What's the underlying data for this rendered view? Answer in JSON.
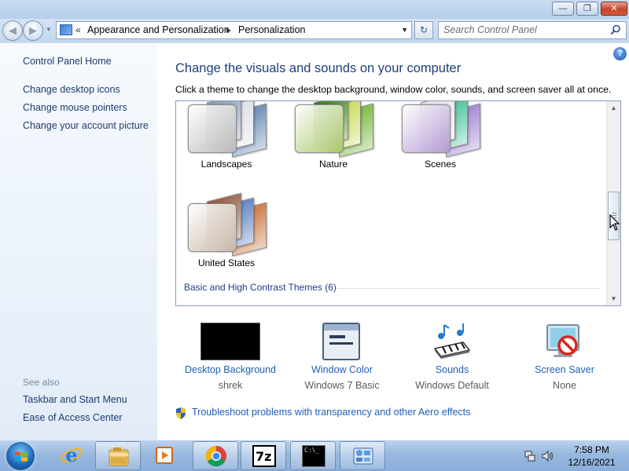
{
  "window": {
    "minimize_glyph": "—",
    "maximize_glyph": "❐",
    "close_glyph": "✕"
  },
  "navigation": {
    "back_glyph": "◀",
    "forward_glyph": "▶",
    "recent_glyph": "▼",
    "address_prefix": "«",
    "separator": "▸",
    "breadcrumbs": [
      "Appearance and Personalization",
      "Personalization"
    ],
    "address_dropdown_glyph": "▼",
    "refresh_glyph": "↻",
    "search_placeholder": "Search Control Panel"
  },
  "sidebar": {
    "home": "Control Panel Home",
    "tasks": [
      "Change desktop icons",
      "Change mouse pointers",
      "Change your account picture"
    ],
    "see_also_label": "See also",
    "see_also": [
      "Taskbar and Start Menu",
      "Ease of Access Center"
    ]
  },
  "main": {
    "help_glyph": "?",
    "title": "Change the visuals and sounds on your computer",
    "subtitle": "Click a theme to change the desktop background, window color, sounds, and screen saver all at once.",
    "themes": [
      {
        "name": "Landscapes",
        "tint": "#b9b9b9",
        "tiles": [
          "#5a7fb0",
          "#d9dde6",
          "#8a9fb8"
        ]
      },
      {
        "name": "Nature",
        "tint": "#a9c76a",
        "tiles": [
          "#6fb32c",
          "#c5d94d",
          "#3f7f22"
        ]
      },
      {
        "name": "Scenes",
        "tint": "#b49ad2",
        "tiles": [
          "#9a7bd0",
          "#3fbf92",
          "#e4e1ea"
        ]
      },
      {
        "name": "United States",
        "tint": "#c9b7a7",
        "tiles": [
          "#c96a2c",
          "#4e78b8",
          "#8e5a3f"
        ]
      }
    ],
    "basic_group": "Basic and High Contrast Themes (6)",
    "bottom": [
      {
        "link": "Desktop Background",
        "value": "shrek",
        "icon": "desktop-background-icon"
      },
      {
        "link": "Window Color",
        "value": "Windows 7 Basic",
        "icon": "window-color-icon"
      },
      {
        "link": "Sounds",
        "value": "Windows Default",
        "icon": "sounds-icon"
      },
      {
        "link": "Screen Saver",
        "value": "None",
        "icon": "screen-saver-icon"
      }
    ],
    "troubleshoot": "Troubleshoot problems with transparency and other Aero effects"
  },
  "taskbar": {
    "apps": [
      "internet-explorer-icon",
      "file-explorer-icon",
      "media-player-icon",
      "chrome-icon",
      "7zip-icon",
      "command-prompt-icon",
      "control-panel-icon"
    ],
    "cmd_prompt_text": "C:\\_",
    "zip_text": "7z",
    "time": "7:58 PM",
    "date": "12/16/2021"
  },
  "colors": {
    "link": "#1f5fb5",
    "heading": "#1e3f7a",
    "sidebar_link": "#1f3a6e"
  }
}
